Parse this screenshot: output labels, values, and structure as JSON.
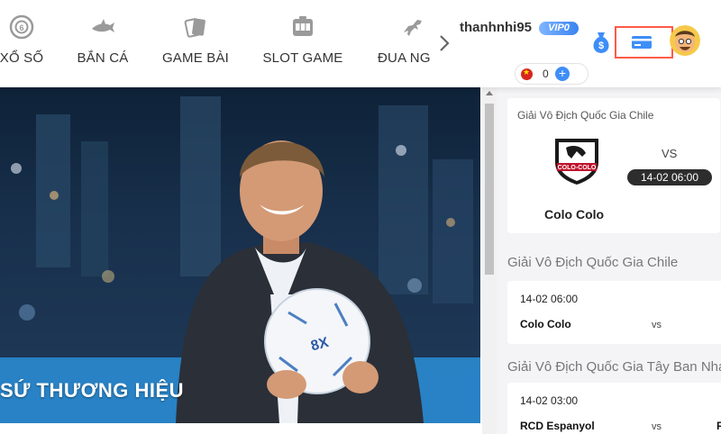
{
  "nav": {
    "items": [
      {
        "label": "XỔ SỐ",
        "icon": "lottery-ball-icon"
      },
      {
        "label": "BẮN CÁ",
        "icon": "shark-icon"
      },
      {
        "label": "GAME BÀI",
        "icon": "cards-icon"
      },
      {
        "label": "SLOT GAME",
        "icon": "slot-machine-icon"
      },
      {
        "label": "ĐUA NG",
        "icon": "racing-horse-icon"
      }
    ],
    "next_icon": "chevron-right-icon"
  },
  "user": {
    "username": "thanhnhi95",
    "vip": "VIP0",
    "balance": "0",
    "currency_flag": "vietnam-flag-icon"
  },
  "actions": {
    "money_icon": "money-bag-icon",
    "card_icon": "credit-card-icon",
    "avatar_icon": "avatar"
  },
  "banner": {
    "tagline": "SỨ THƯƠNG HIỆU",
    "ball_brand": "8X bet"
  },
  "featured": {
    "league": "Giải Vô Địch Quốc Gia Chile",
    "crest_text": "COLO-COLO",
    "vs": "VS",
    "time": "14-02 06:00",
    "team": "Colo Colo"
  },
  "sections": [
    {
      "title": "Giải Vô Địch Quốc Gia Chile",
      "time": "14-02 06:00",
      "home": "Colo Colo",
      "vs": "vs",
      "away": ""
    },
    {
      "title": "Giải Vô Địch Quốc Gia Tây Ban Nha",
      "time": "14-02 03:00",
      "home": "RCD Espanyol",
      "vs": "vs",
      "away": "F"
    }
  ],
  "colors": {
    "accent_blue": "#3e8ef7",
    "highlight_border": "#ff5a47",
    "time_pill": "#2d2d2d",
    "panel_bg": "#f4f4f6"
  }
}
